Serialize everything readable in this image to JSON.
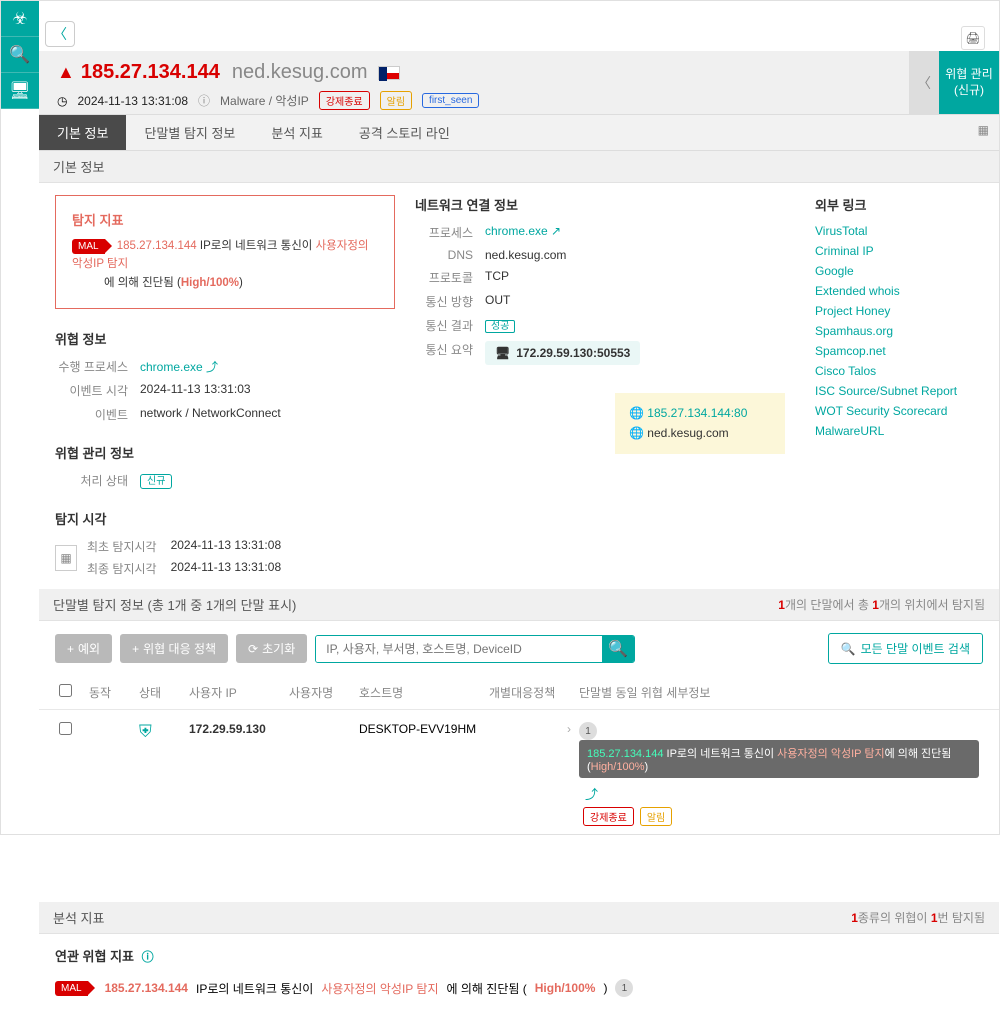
{
  "header": {
    "ip": "185.27.134.144",
    "host": "ned.kesug.com",
    "timestamp": "2024-11-13 13:31:08",
    "classification": "Malware / 악성IP",
    "chips": [
      "강제종료",
      "알림",
      "first_seen"
    ],
    "right_panel_title": "위협 관리",
    "right_panel_sub": "(신규)"
  },
  "tabs": [
    "기본 정보",
    "단말별 탐지 정보",
    "분석 지표",
    "공격 스토리 라인"
  ],
  "section_basic": "기본 정보",
  "indicator": {
    "title": "탐지 지표",
    "mal": "MAL",
    "ip": "185.27.134.144",
    "text1": " IP로의 네트워크 통신이 ",
    "hl": "사용자정의 악성IP 탐지",
    "text2": "에 의해 진단됨 (",
    "score": "High/100%",
    "text3": ")"
  },
  "threat_info_title": "위협 정보",
  "threat_info": {
    "proc_k": "수행 프로세스",
    "proc_v": "chrome.exe",
    "evt_time_k": "이벤트 시각",
    "evt_time_v": "2024-11-13 13:31:03",
    "evt_k": "이벤트",
    "evt_v": "network / NetworkConnect"
  },
  "mgmt_title": "위협 관리 정보",
  "mgmt": {
    "status_k": "처리 상태",
    "status_v": "신규"
  },
  "detect_title": "탐지 시각",
  "detect": {
    "first_k": "최초 탐지시각",
    "first_v": "2024-11-13 13:31:08",
    "last_k": "최종 탐지시각",
    "last_v": "2024-11-13 13:31:08"
  },
  "net_title": "네트워크 연결 정보",
  "net": {
    "proc_k": "프로세스",
    "proc_v": "chrome.exe",
    "dns_k": "DNS",
    "dns_v": "ned.kesug.com",
    "proto_k": "프로토콜",
    "proto_v": "TCP",
    "dir_k": "통신 방향",
    "dir_v": "OUT",
    "res_k": "통신 결과",
    "res_v": "성공",
    "sum_k": "통신 요약",
    "sum_v": "172.29.59.130:50553"
  },
  "yellow": {
    "line1": "185.27.134.144:80",
    "line2": "ned.kesug.com"
  },
  "ext_title": "외부 링크",
  "ext_links": [
    "VirusTotal",
    "Criminal IP",
    "Google",
    "Extended whois",
    "Project Honey",
    "Spamhaus.org",
    "Spamcop.net",
    "Cisco Talos",
    "ISC Source/Subnet Report",
    "WOT Security Scorecard",
    "MalwareURL"
  ],
  "per_terminal_hdr": "단말별 탐지 정보 (총 1개 중 1개의 단말 표시)",
  "per_terminal_stats": {
    "a": "1",
    "b": "개의 단말에서 총 ",
    "c": "1",
    "d": "개의 위치에서 탐지됨"
  },
  "toolbar": {
    "btn1": "예외",
    "btn2": "위협 대응 정책",
    "btn3": "초기화",
    "search_ph": "IP, 사용자, 부서명, 호스트명, DeviceID",
    "btn_search": "모든 단말 이벤트 검색"
  },
  "table_head": {
    "action": "동작",
    "status": "상태",
    "ip": "사용자 IP",
    "user": "사용자명",
    "host": "호스트명",
    "policy": "개별대응정책",
    "detail": "단말별 동일 위협 세부정보"
  },
  "row": {
    "ip": "172.29.59.130",
    "host": "DESKTOP-EVV19HM",
    "count": "1",
    "det_ip": "185.27.134.144",
    "det_t1": " IP로의 네트워크 통신이 ",
    "det_hl": "사용자정의 악성IP 탐지",
    "det_t2": "에 의해 진단됨 (",
    "det_score": "High/100%",
    "det_t3": ")",
    "chips": [
      "강제종료",
      "알림"
    ]
  },
  "analysis_hdr": "분석 지표",
  "analysis_stats": {
    "a": "1",
    "b": "종류의 위협이 ",
    "c": "1",
    "d": "번 탐지됨"
  },
  "related_title": "연관 위협 지표",
  "related": {
    "ip": "185.27.134.144",
    "t1": " IP로의 네트워크 통신이 ",
    "hl": "사용자정의 악성IP 탐지",
    "t2": "에 의해 진단됨 (",
    "score": "High/100%",
    "t3": ")",
    "count": "1"
  }
}
